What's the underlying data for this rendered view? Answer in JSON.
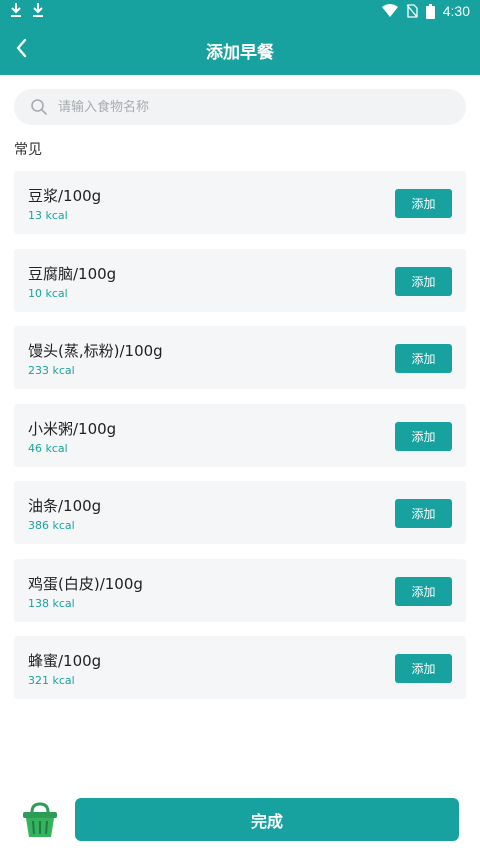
{
  "status_bar": {
    "time": "4:30",
    "icons": [
      "download-icon",
      "download-icon",
      "wifi-icon",
      "no-sim-icon",
      "battery-icon"
    ]
  },
  "header": {
    "title": "添加早餐",
    "back_icon": "chevron-left-icon"
  },
  "search": {
    "placeholder": "请输入食物名称",
    "value": ""
  },
  "section": {
    "title": "常见"
  },
  "foods": [
    {
      "name": "豆浆/100g",
      "kcal": "13 kcal",
      "add_label": "添加"
    },
    {
      "name": "豆腐脑/100g",
      "kcal": "10 kcal",
      "add_label": "添加"
    },
    {
      "name": "馒头(蒸,标粉)/100g",
      "kcal": "233 kcal",
      "add_label": "添加"
    },
    {
      "name": "小米粥/100g",
      "kcal": "46 kcal",
      "add_label": "添加"
    },
    {
      "name": "油条/100g",
      "kcal": "386 kcal",
      "add_label": "添加"
    },
    {
      "name": "鸡蛋(白皮)/100g",
      "kcal": "138 kcal",
      "add_label": "添加"
    },
    {
      "name": "蜂蜜/100g",
      "kcal": "321 kcal",
      "add_label": "添加"
    }
  ],
  "footer": {
    "basket_icon": "basket-icon",
    "done_label": "完成"
  },
  "colors": {
    "primary": "#17a2a0",
    "item_bg": "#f5f6f8",
    "kcal_text": "#1aa3a0"
  }
}
